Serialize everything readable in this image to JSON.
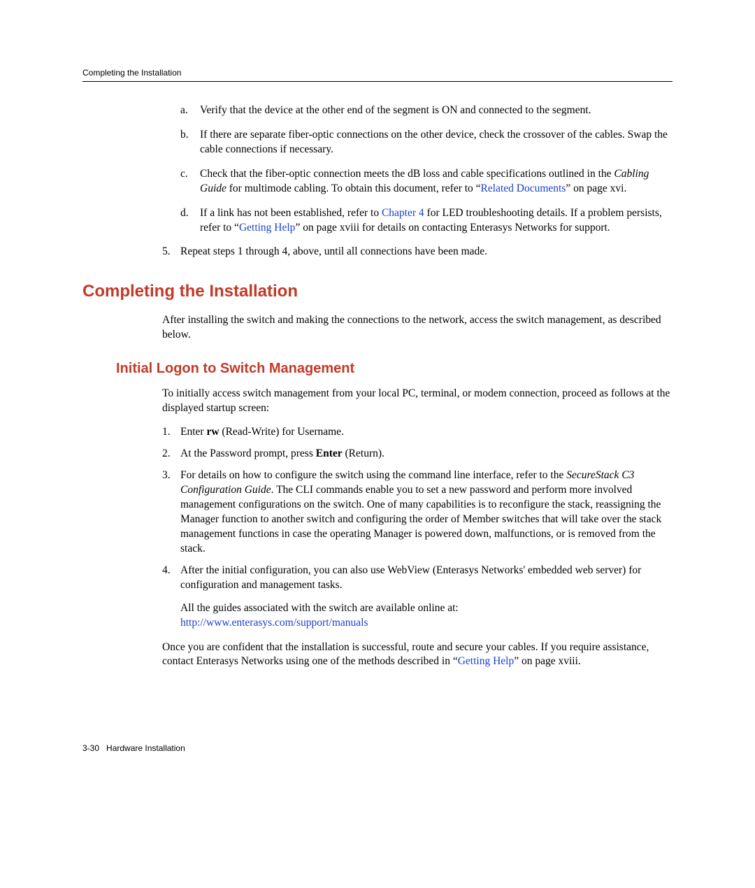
{
  "header_title": "Completing the Installation",
  "sub_items": {
    "a": "Verify that the device at the other end of the segment is ON and connected to the segment.",
    "b": "If there are separate fiber-optic connections on the other device, check the crossover of the cables. Swap the cable connections if necessary.",
    "c_pre": "Check that the fiber-optic connection meets the dB loss and cable specifications outlined in the ",
    "c_italic": "Cabling Guide",
    "c_mid": " for multimode cabling. To obtain this document, refer to “",
    "c_link": "Related Documents",
    "c_post": "”  on page xvi.",
    "d_pre": "If a link has not been established, refer to ",
    "d_link1": "Chapter 4",
    "d_mid1": " for LED troubleshooting details. If a problem persists, refer to “",
    "d_link2": "Getting Help",
    "d_post": "”  on page xviii for details on contacting Enterasys Networks for support."
  },
  "step5": "Repeat steps 1 through 4, above, until all connections have been made.",
  "h1": "Completing the Installation",
  "h1_para": "After installing the switch and making the connections to the network, access the switch management, as described below.",
  "h2": "Initial Logon to Switch Management",
  "h2_intro": "To initially access switch management from your local PC, terminal, or modem connection, proceed as follows at the displayed startup screen:",
  "steps": {
    "s1_pre": "Enter ",
    "s1_bold": "rw",
    "s1_post": " (Read-Write) for Username.",
    "s2_pre": "At the Password prompt, press ",
    "s2_bold": "Enter",
    "s2_post": " (Return).",
    "s3_pre": "For details on how to configure the switch using the command line interface, refer to the ",
    "s3_italic": "SecureStack C3 Configuration Guide",
    "s3_post": ". The CLI commands enable you to set a new password and perform more involved management configurations on the switch. One of many capabilities is to reconfigure the stack, reassigning the Manager function to another switch and configuring the order of Member switches that will take over the stack management functions in case the operating Manager is powered down, malfunctions, or is removed from the stack.",
    "s4": "After the initial configuration, you can also use WebView (Enterasys Networks' embedded web server) for configuration and management tasks.",
    "s4_note": "All the guides associated with the switch are available online at:",
    "s4_url": "http://www.enterasys.com/support/manuals"
  },
  "closing_pre": "Once you are confident that the installation is successful, route and secure your cables. If you require assistance, contact Enterasys Networks using one of the methods described in “",
  "closing_link": "Getting Help",
  "closing_post": "”  on page xviii.",
  "footer_page": "3-30",
  "footer_title": "Hardware Installation"
}
